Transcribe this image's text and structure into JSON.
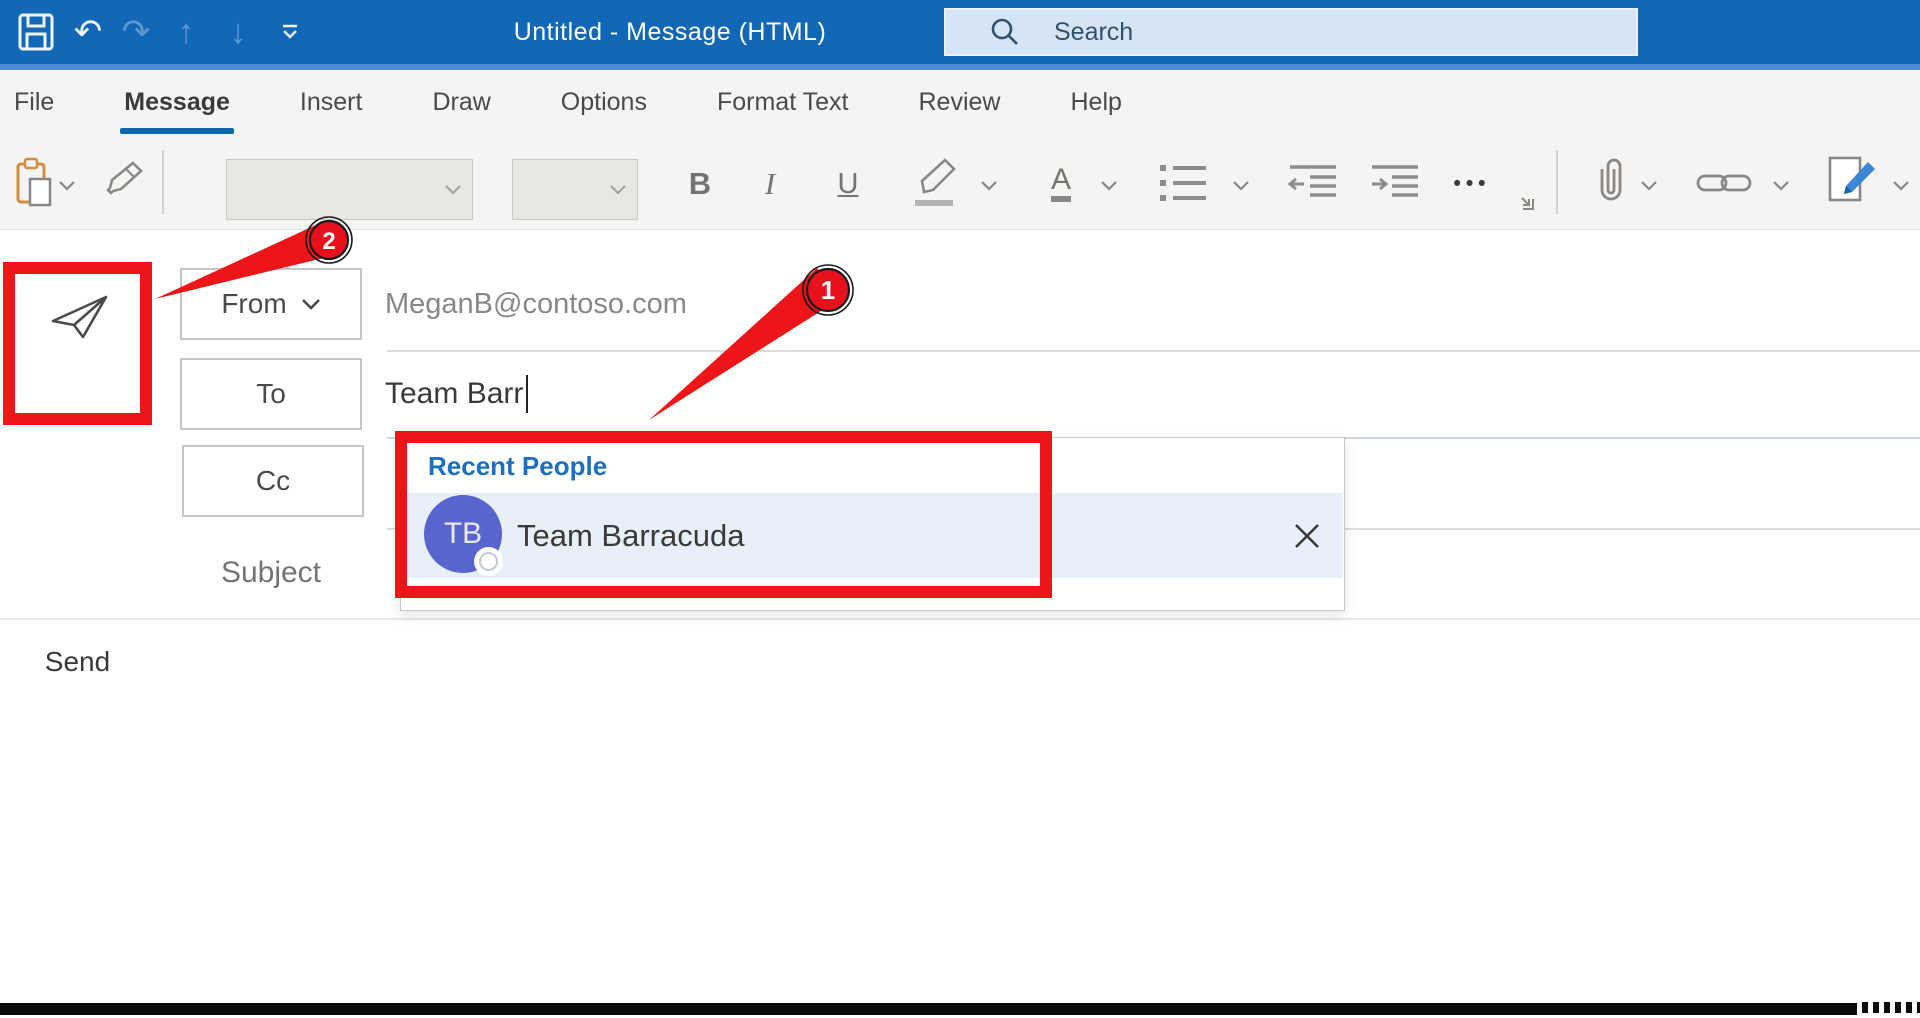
{
  "window": {
    "title": "Untitled  -  Message (HTML)"
  },
  "quick_access": {
    "glyphs": {
      "undo": "↶",
      "redo": "↷",
      "move_up": "↑",
      "move_down": "↓"
    }
  },
  "search": {
    "placeholder": "Search"
  },
  "ribbon": {
    "tabs": [
      {
        "label": "File",
        "active": false
      },
      {
        "label": "Message",
        "active": true
      },
      {
        "label": "Insert",
        "active": false
      },
      {
        "label": "Draw",
        "active": false
      },
      {
        "label": "Options",
        "active": false
      },
      {
        "label": "Format Text",
        "active": false
      },
      {
        "label": "Review",
        "active": false
      },
      {
        "label": "Help",
        "active": false
      }
    ]
  },
  "toolbar": {
    "bold": "B",
    "italic": "I",
    "underline": "U",
    "font_color": "A",
    "more": "•••"
  },
  "compose": {
    "send": "Send",
    "from_label": "From",
    "from_value": "MeganB@contoso.com",
    "to_label": "To",
    "to_value": "Team Barr",
    "cc_label": "Cc",
    "subject_label": "Subject"
  },
  "suggestions": {
    "header": "Recent People",
    "items": [
      {
        "initials": "TB",
        "name": "Team Barracuda"
      }
    ]
  },
  "annotations": {
    "badge_1": "1",
    "badge_2": "2"
  },
  "colors": {
    "titlebar_blue": "#1268b6",
    "accent_red": "#ee1518",
    "suggestion_header_blue": "#1e6fc0",
    "avatar_purple": "#5a64cf",
    "row_highlight": "#e7f0fa",
    "tab_underline": "#1165ab"
  }
}
